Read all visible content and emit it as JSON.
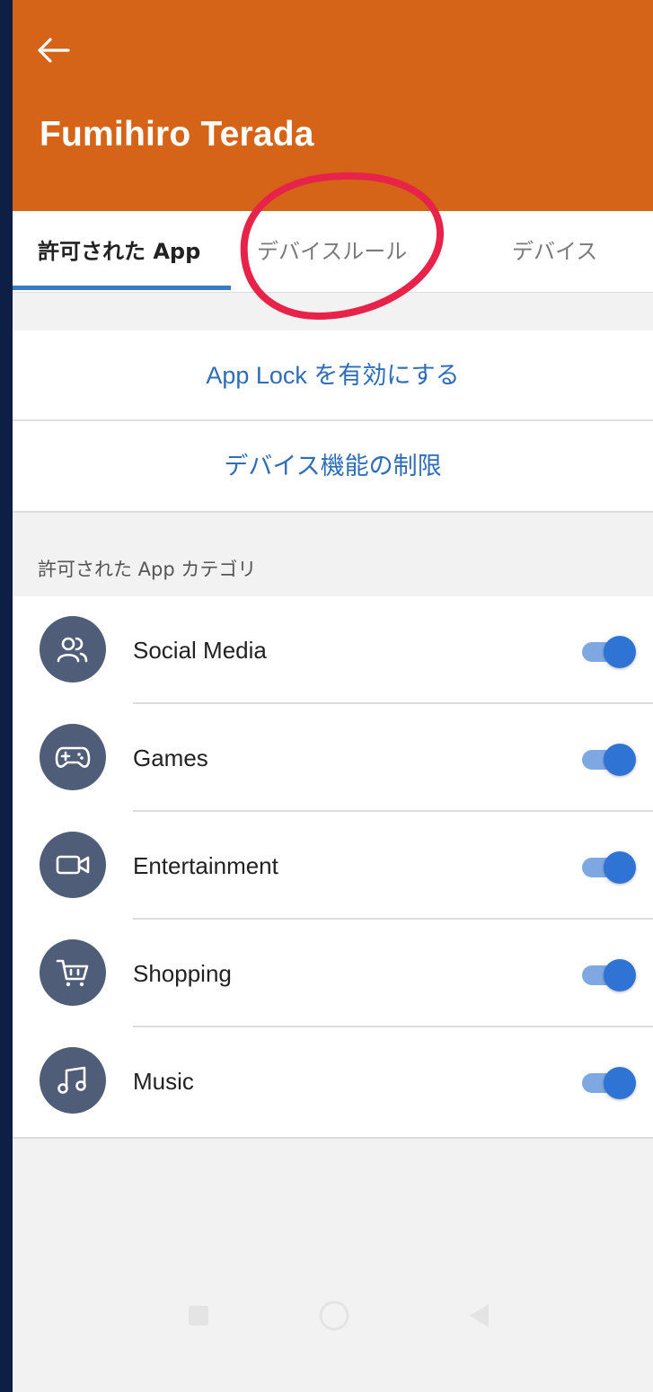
{
  "header": {
    "title": "Fumihiro Terada"
  },
  "tabs": [
    {
      "label": "許可された App",
      "active": true
    },
    {
      "label": "デバイスルール",
      "active": false
    },
    {
      "label": "デバイス",
      "active": false
    }
  ],
  "actions": {
    "app_lock": "App Lock を有効にする",
    "device_restrictions": "デバイス機能の制限"
  },
  "section_label": "許可された App カテゴリ",
  "categories": [
    {
      "label": "Social Media",
      "icon": "people-icon",
      "enabled": true
    },
    {
      "label": "Games",
      "icon": "gamepad-icon",
      "enabled": true
    },
    {
      "label": "Entertainment",
      "icon": "video-camera-icon",
      "enabled": true
    },
    {
      "label": "Shopping",
      "icon": "shopping-cart-icon",
      "enabled": true
    },
    {
      "label": "Music",
      "icon": "music-note-icon",
      "enabled": true
    }
  ],
  "colors": {
    "app_bar": "#d66418",
    "accent": "#2f73d4",
    "link": "#2f6db7",
    "annotation": "#e8234a"
  }
}
